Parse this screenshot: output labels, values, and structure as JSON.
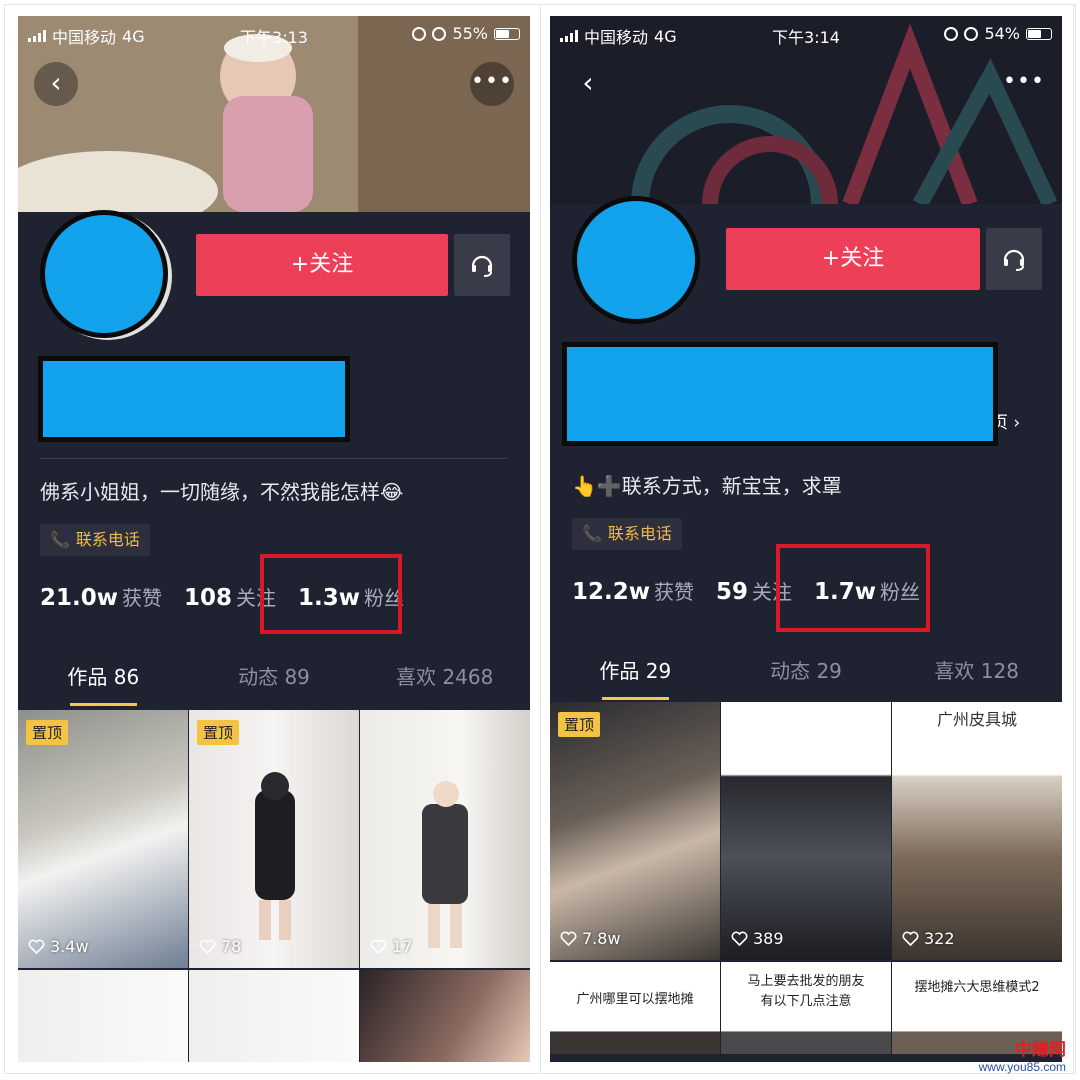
{
  "watermark": {
    "logo": "中赚网",
    "url": "www.you85.com"
  },
  "phones": [
    {
      "status": {
        "carrier": "中国移动",
        "network": "4G",
        "time": "下午3:13",
        "battery_pct": 55,
        "battery_text": "55%"
      },
      "follow_label": "+关注",
      "bio": "佛系小姐姐，一切随缘，不然我能怎样😂",
      "contact_label": "联系电话",
      "stats": {
        "likes": {
          "num": "21.0w",
          "label": "获赞"
        },
        "following": {
          "num": "108",
          "label": "关注"
        },
        "fans": {
          "num": "1.3w",
          "label": "粉丝"
        }
      },
      "tabs": [
        {
          "label": "作品 86"
        },
        {
          "label": "动态 89"
        },
        {
          "label": "喜欢 2468"
        }
      ],
      "videos": [
        {
          "pinned": "置顶",
          "likes": "3.4w"
        },
        {
          "pinned": "置顶",
          "likes": "78"
        },
        {
          "likes": "17"
        }
      ]
    },
    {
      "status": {
        "carrier": "中国移动",
        "network": "4G",
        "time": "下午3:14",
        "battery_pct": 54,
        "battery_text": "54%"
      },
      "follow_label": "+关注",
      "homepage_link": "主页 ›",
      "bio": "👆➕联系方式，新宝宝，求罩",
      "contact_label": "联系电话",
      "stats": {
        "likes": {
          "num": "12.2w",
          "label": "获赞"
        },
        "following": {
          "num": "59",
          "label": "关注"
        },
        "fans": {
          "num": "1.7w",
          "label": "粉丝"
        }
      },
      "tabs": [
        {
          "label": "作品 29"
        },
        {
          "label": "动态 29"
        },
        {
          "label": "喜欢 128"
        }
      ],
      "videos": [
        {
          "pinned": "置顶",
          "likes": "7.8w"
        },
        {
          "likes": "389"
        },
        {
          "top_caption": "广州皮具城",
          "likes": "322"
        }
      ],
      "text_tiles": [
        {
          "caption": "广州哪里可以摆地摊"
        },
        {
          "caption": "马上要去批发的朋友\n有以下几点注意"
        },
        {
          "caption": "摆地摊六大思维模式2"
        }
      ]
    }
  ]
}
